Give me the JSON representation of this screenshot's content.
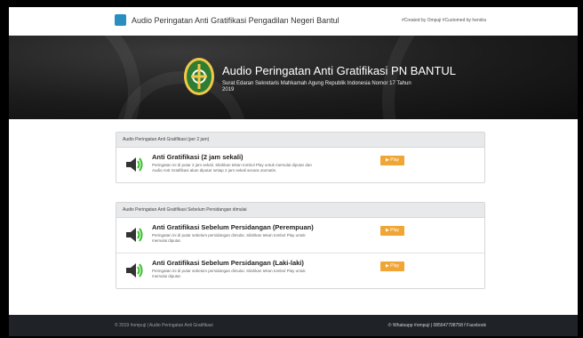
{
  "navbar": {
    "brand_title": "Audio Peringatan Anti Gratifikasi Pengadilan Negeri Bantul",
    "credit": "#Created by Ompuji #Customed by hendra"
  },
  "hero": {
    "title": "Audio Peringatan Anti Gratifikasi PN BANTUL",
    "subtitle": "Surat Edaran Sekretaris Mahkamah Agung Republik Indonesia Nomor 17 Tahun 2019"
  },
  "sections": [
    {
      "heading": "Audio Peringatan Anti Gratifikasi (per 2 jam)",
      "items": [
        {
          "title": "Anti Gratifikasi (2 jam sekali)",
          "description": "Peringatan ini di putar 2 jam sekali. Silahkan tekan tombol Play untuk memulai diputar dan Audio Anti Gratifikasi akan diputar setiap 2 jam sekali secara otomatis.",
          "button": "Play"
        }
      ]
    },
    {
      "heading": "Audio Peringatan Anti Gratifikasi Sebelum Persidangan dimulai",
      "items": [
        {
          "title": "Anti Gratifikasi Sebelum Persidangan (Perempuan)",
          "description": "Peringatan ini di putar sebelum persidangan dimulai. Silahkan tekan tombol Play untuk memulai diputar.",
          "button": "Play"
        },
        {
          "title": "Anti Gratifikasi Sebelum Persidangan (Laki-laki)",
          "description": "Peringatan ini di putar sebelum persidangan dimulai. Silahkan tekan tombol Play untuk memulai diputar.",
          "button": "Play"
        }
      ]
    }
  ],
  "footer": {
    "left": "© 2019 #ompuji | Audio Peringatan Anti Gratifikasi",
    "right": "✆ Whatsapp #ompuji | 085647798758  f Facebook"
  },
  "colors": {
    "play_button": "#f0a534",
    "footer_bg": "#1f2327",
    "panel_header_bg": "#e8e9ea",
    "speaker_green": "#3bbf2f"
  },
  "icons": [
    "brand-logo-icon",
    "court-emblem-icon",
    "speaker-icon",
    "play-icon"
  ]
}
